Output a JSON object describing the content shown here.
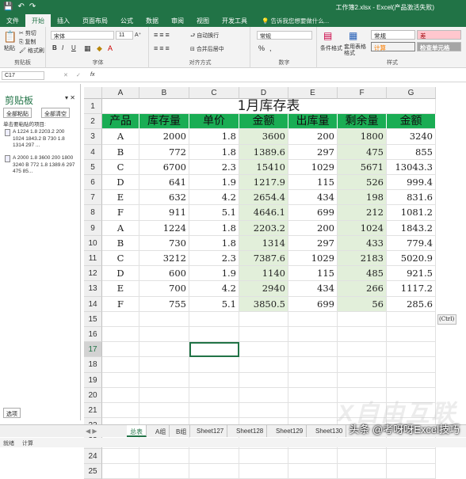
{
  "window": {
    "title": "工作簿2.xlsx - Excel(产品激活失败)"
  },
  "quick_access": {
    "save": "💾",
    "undo": "↶",
    "redo": "↷"
  },
  "menu": {
    "tabs": [
      "文件",
      "开始",
      "插入",
      "页面布局",
      "公式",
      "数据",
      "审阅",
      "视图",
      "开发工具"
    ],
    "active": "开始",
    "tell_me": "告诉我您想要做什么..."
  },
  "ribbon": {
    "clipboard": {
      "paste": "粘贴",
      "cut": "剪切",
      "copy": "复制",
      "format_painter": "格式刷",
      "label": "剪贴板"
    },
    "font": {
      "name": "宋体",
      "size": "11",
      "grow": "A⁺",
      "shrink": "A⁻",
      "bold": "B",
      "italic": "I",
      "underline": "U",
      "label": "字体"
    },
    "alignment": {
      "wrap": "自动换行",
      "merge": "合并后居中",
      "label": "对齐方式"
    },
    "number": {
      "format": "常规",
      "percent": "%",
      "comma": ",",
      "label": "数字"
    },
    "styles": {
      "conditional": "条件格式",
      "table": "套用表格格式",
      "normal": "常规",
      "bad": "差",
      "neutral": "计算",
      "check": "检查单元格",
      "label": "样式"
    }
  },
  "formula_bar": {
    "name_box": "C17",
    "cancel": "✕",
    "enter": "✓",
    "fx": "fx",
    "value": ""
  },
  "clipboard_pane": {
    "title": "剪贴板",
    "paste_all": "全部粘贴",
    "clear_all": "全部清空",
    "hint": "单击要粘贴的项目:",
    "items": [
      "A 1224 1.8 2203.2 200 1024 1843.2 B 730 1.8 1314 297 ...",
      "A 2000 1.8 3600 200 1800 3240 B 772 1.8 1389.6 297 475 85..."
    ],
    "options": "选项"
  },
  "sheet": {
    "columns": [
      "A",
      "B",
      "C",
      "D",
      "E",
      "F",
      "G"
    ],
    "rows": [
      "1",
      "2",
      "3",
      "4",
      "5",
      "6",
      "7",
      "8",
      "9",
      "10",
      "11",
      "12",
      "13",
      "14",
      "15",
      "16",
      "17",
      "18",
      "19",
      "20",
      "21",
      "22",
      "23",
      "24",
      "25"
    ],
    "title": "1月库存表",
    "headers": [
      "产品",
      "库存量",
      "单价",
      "金额",
      "出库量",
      "剩余量",
      "金额"
    ],
    "data": [
      [
        "A",
        "2000",
        "1.8",
        "3600",
        "200",
        "1800",
        "3240"
      ],
      [
        "B",
        "772",
        "1.8",
        "1389.6",
        "297",
        "475",
        "855"
      ],
      [
        "C",
        "6700",
        "2.3",
        "15410",
        "1029",
        "5671",
        "13043.3"
      ],
      [
        "D",
        "641",
        "1.9",
        "1217.9",
        "115",
        "526",
        "999.4"
      ],
      [
        "E",
        "632",
        "4.2",
        "2654.4",
        "434",
        "198",
        "831.6"
      ],
      [
        "F",
        "911",
        "5.1",
        "4646.1",
        "699",
        "212",
        "1081.2"
      ],
      [
        "A",
        "1224",
        "1.8",
        "2203.2",
        "200",
        "1024",
        "1843.2"
      ],
      [
        "B",
        "730",
        "1.8",
        "1314",
        "297",
        "433",
        "779.4"
      ],
      [
        "C",
        "3212",
        "2.3",
        "7387.6",
        "1029",
        "2183",
        "5020.9"
      ],
      [
        "D",
        "600",
        "1.9",
        "1140",
        "115",
        "485",
        "921.5"
      ],
      [
        "E",
        "700",
        "4.2",
        "2940",
        "434",
        "266",
        "1117.2"
      ],
      [
        "F",
        "755",
        "5.1",
        "3850.5",
        "699",
        "56",
        "285.6"
      ]
    ],
    "paste_tag": "(Ctrl)"
  },
  "sheet_tabs": [
    "总表",
    "A组",
    "B组",
    "Sheet127",
    "Sheet128",
    "Sheet129",
    "Sheet130"
  ],
  "active_sheet_tab": "总表",
  "status": {
    "ready": "就绪",
    "calc": "计算"
  },
  "watermark": {
    "logo": "X自由互联",
    "text": "头条 @考呀呀Excel技巧"
  },
  "colors": {
    "excel_green": "#217346",
    "header_fill": "#1aad54",
    "data_fill": "#e2efda",
    "bad_fill": "#ffc7ce",
    "neutral_fill": "#ffeb9c"
  }
}
